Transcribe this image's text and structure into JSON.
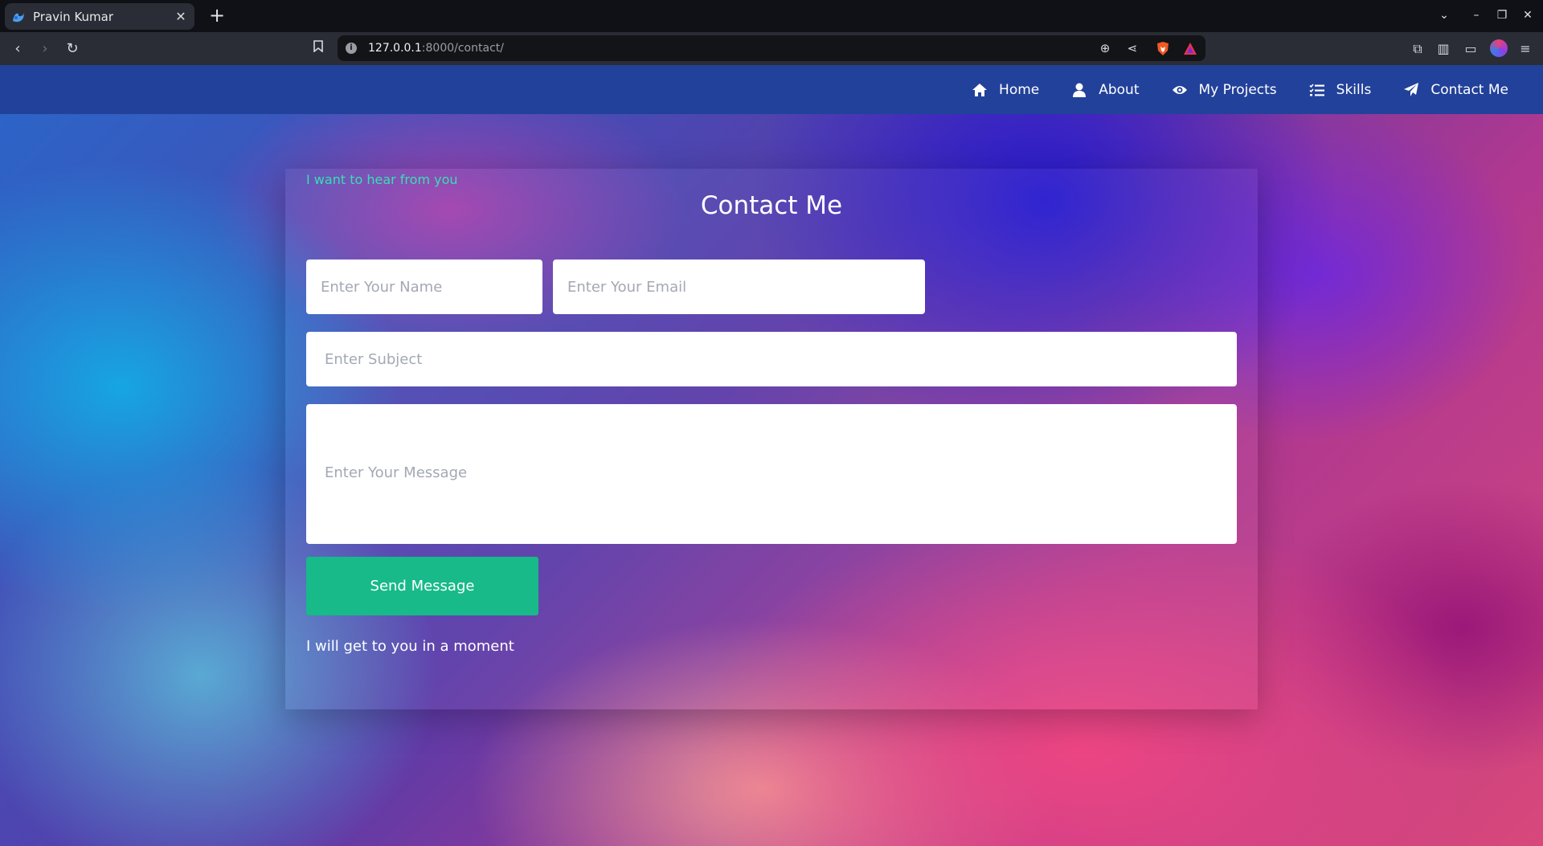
{
  "browser": {
    "tab_title": "Pravin Kumar",
    "url_host": "127.0.0.1",
    "url_path": ":8000/contact/"
  },
  "nav": {
    "items": [
      {
        "label": "Home",
        "icon": "home-icon"
      },
      {
        "label": "About",
        "icon": "user-icon"
      },
      {
        "label": "My Projects",
        "icon": "eye-icon"
      },
      {
        "label": "Skills",
        "icon": "list-check-icon"
      },
      {
        "label": "Contact Me",
        "icon": "paper-plane-icon"
      }
    ]
  },
  "contact": {
    "eyebrow": "I want to hear from you",
    "title": "Contact Me",
    "name_placeholder": "Enter Your Name",
    "email_placeholder": "Enter Your Email",
    "subject_placeholder": "Enter Subject",
    "message_placeholder": "Enter Your Message",
    "submit_label": "Send Message",
    "footnote": "I will get to you in a moment"
  },
  "colors": {
    "header": "#22419a",
    "accent": "#17ba88",
    "eyebrow": "#34e0b4"
  }
}
